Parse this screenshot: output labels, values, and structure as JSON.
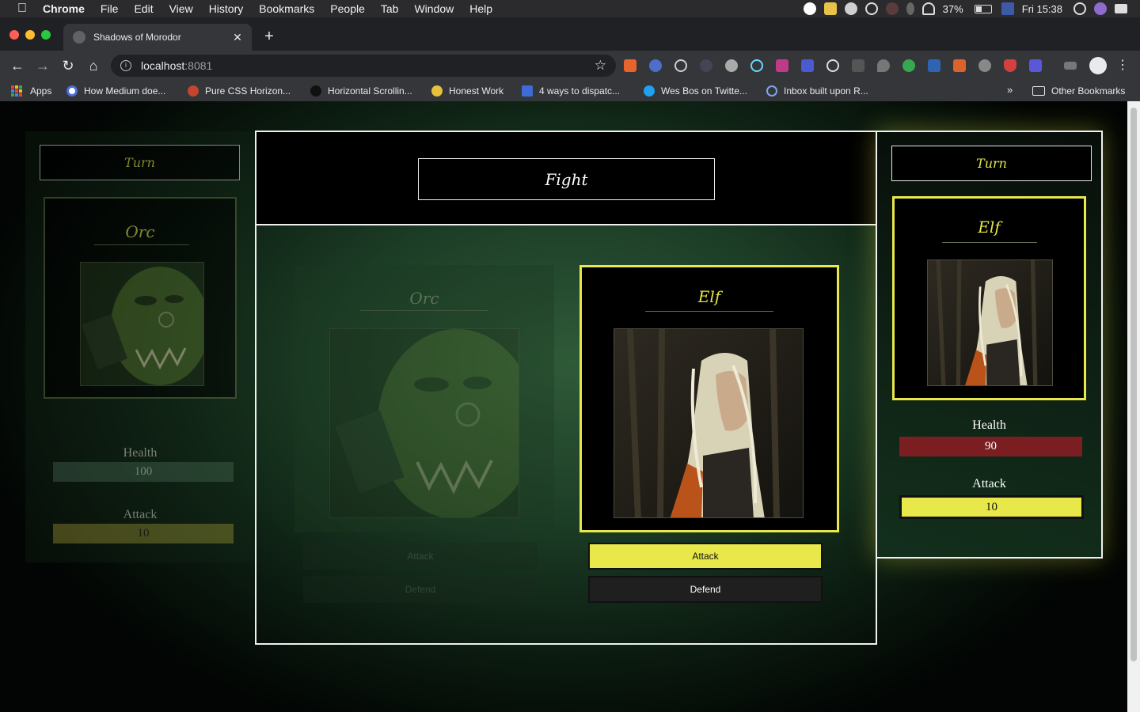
{
  "menubar": {
    "app": "Chrome",
    "items": [
      "File",
      "Edit",
      "View",
      "History",
      "Bookmarks",
      "People",
      "Tab",
      "Window",
      "Help"
    ],
    "battery": "37%",
    "clock": "Fri 15:38"
  },
  "browser": {
    "tab_title": "Shadows of Morodor",
    "url_host": "localhost",
    "url_port": ":8081",
    "bookmarks": [
      "Apps",
      "How Medium doe...",
      "Pure CSS Horizon...",
      "Horizontal Scrollin...",
      "Honest Work",
      "4 ways to dispatc...",
      "Wes Bos on Twitte...",
      "Inbox built upon R..."
    ],
    "overflow": "»",
    "other_bookmarks": "Other Bookmarks"
  },
  "game": {
    "fight_label": "Fight",
    "left_player": {
      "turn_label": "Turn",
      "name": "Orc",
      "health_label": "Health",
      "health": "100",
      "attack_label": "Attack",
      "attack": "10",
      "active": false
    },
    "right_player": {
      "turn_label": "Turn",
      "name": "Elf",
      "health_label": "Health",
      "health": "90",
      "attack_label": "Attack",
      "attack": "10",
      "active": true
    },
    "arena": {
      "orc_name": "Orc",
      "elf_name": "Elf",
      "attack_button": "Attack",
      "defend_button": "Defend"
    }
  },
  "colors": {
    "accent_yellow": "#e8e84a",
    "health_red": "#7a1e22",
    "health_dim": "#3b5a45",
    "border": "#f0f0f0"
  }
}
